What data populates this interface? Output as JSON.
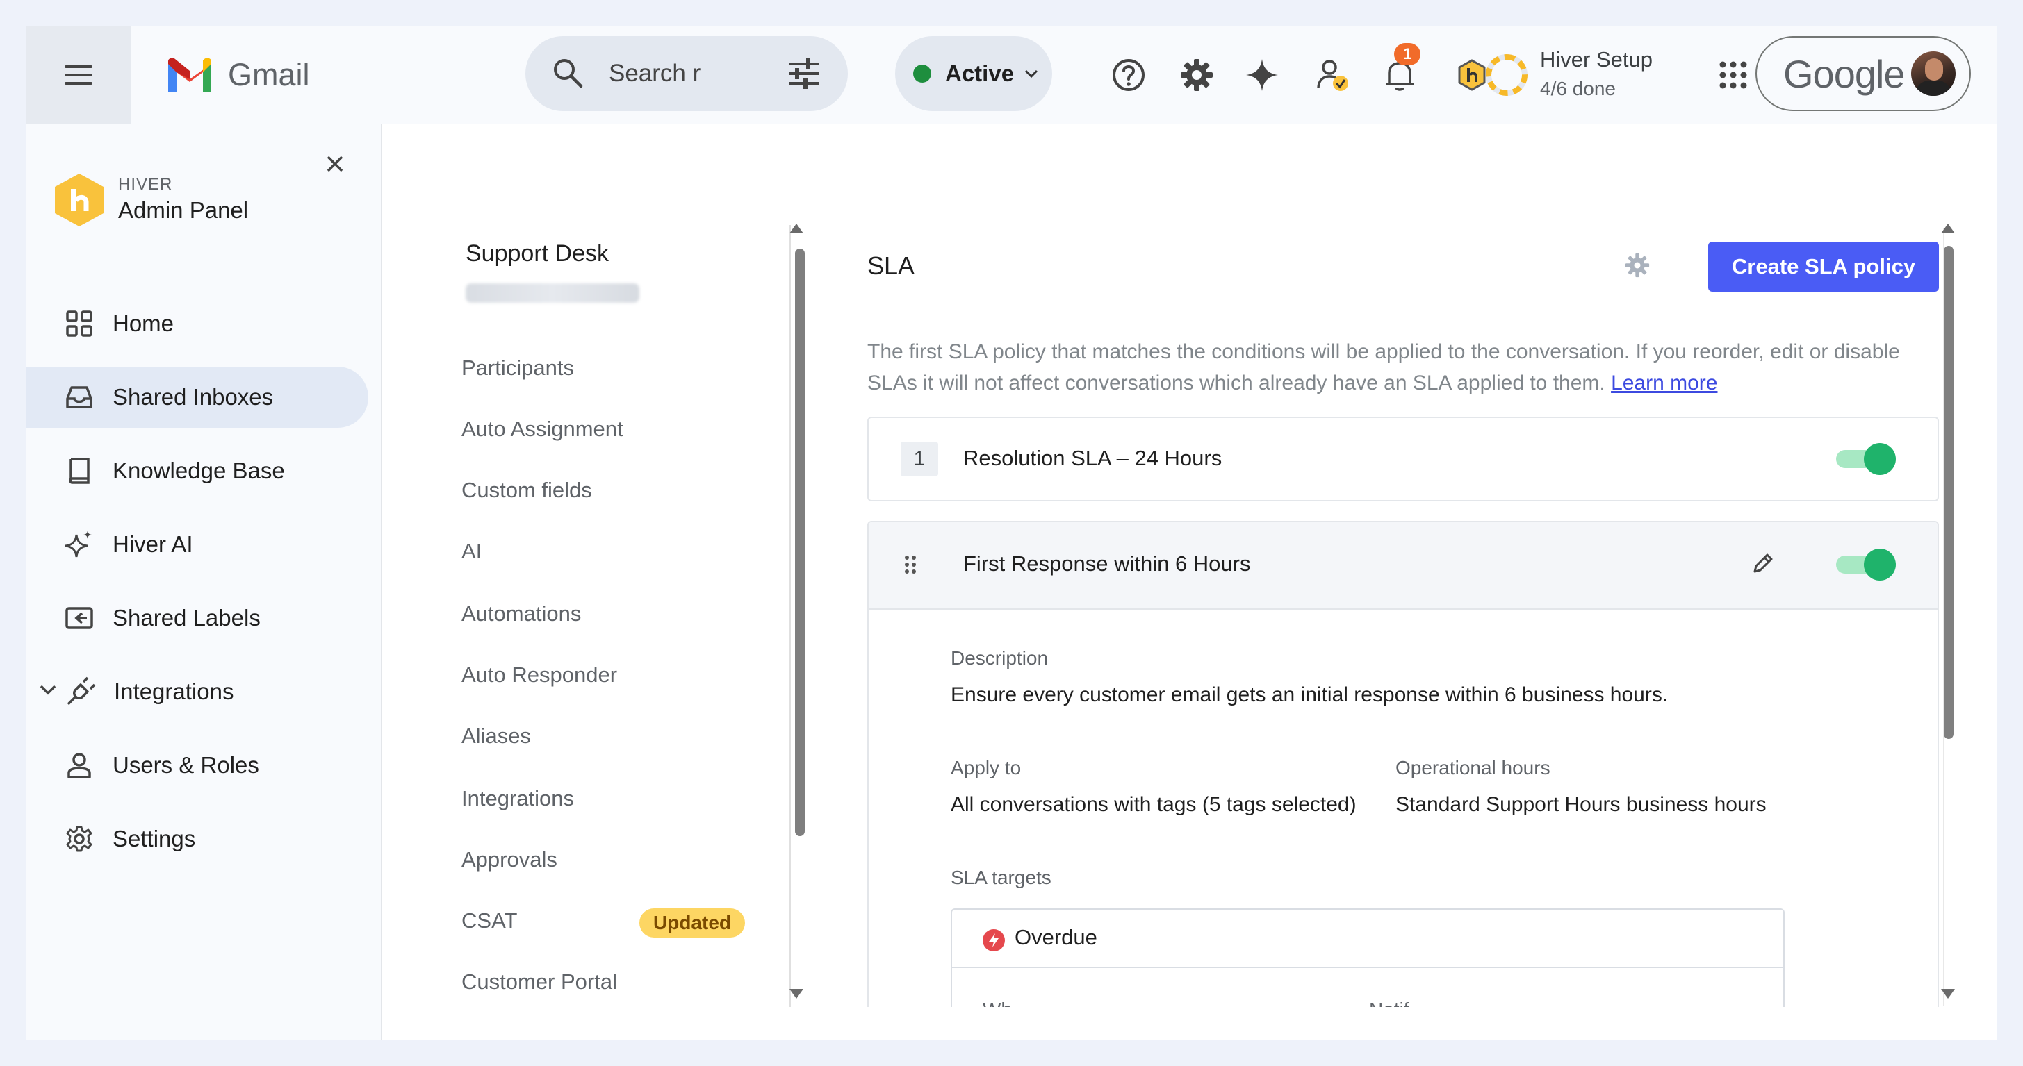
{
  "topbar": {
    "app_name": "Gmail",
    "search_placeholder": "Search r",
    "status_label": "Active",
    "notification_count": "1",
    "setup_title": "Hiver Setup",
    "setup_progress": "4/6 done",
    "setup_fraction": 0.667,
    "account_brand": "Google"
  },
  "sidebar": {
    "brand_top": "HIVER",
    "brand_bottom": "Admin Panel",
    "items": [
      {
        "label": "Home",
        "icon": "grid-icon"
      },
      {
        "label": "Shared Inboxes",
        "icon": "inbox-icon",
        "active": true
      },
      {
        "label": "Knowledge Base",
        "icon": "book-icon"
      },
      {
        "label": "Hiver AI",
        "icon": "sparkle-icon"
      },
      {
        "label": "Shared Labels",
        "icon": "label-icon"
      },
      {
        "label": "Integrations",
        "icon": "plug-icon"
      },
      {
        "label": "Users & Roles",
        "icon": "user-icon"
      },
      {
        "label": "Settings",
        "icon": "gear-icon"
      }
    ]
  },
  "subnav": {
    "title": "Support Desk",
    "items": [
      {
        "label": "Participants"
      },
      {
        "label": "Auto Assignment"
      },
      {
        "label": "Custom fields"
      },
      {
        "label": "AI"
      },
      {
        "label": "Automations"
      },
      {
        "label": "Auto Responder"
      },
      {
        "label": "Aliases"
      },
      {
        "label": "Integrations"
      },
      {
        "label": "Approvals"
      },
      {
        "label": "CSAT",
        "badge": "Updated"
      },
      {
        "label": "Customer Portal"
      }
    ]
  },
  "sla": {
    "title": "SLA",
    "create_button": "Create SLA policy",
    "intro": "The first SLA policy that matches the conditions will be applied to the conversation. If you reorder, edit or disable SLAs it will not affect conversations which already have an SLA applied to them.",
    "learn_more": "Learn more",
    "policies": [
      {
        "number": "1",
        "name": "Resolution SLA – 24 Hours",
        "enabled": true
      },
      {
        "name": "First Response within 6 Hours",
        "enabled": true,
        "description_label": "Description",
        "description": "Ensure every customer email gets an initial response within 6 business hours.",
        "apply_to_label": "Apply to",
        "apply_to": "All conversations with tags (5 tags selected)",
        "hours_label": "Operational hours",
        "hours": "Standard Support Hours business hours",
        "targets_label": "SLA targets",
        "target_name": "Overdue",
        "col_when": "Wh",
        "col_notify": "Notif"
      }
    ]
  },
  "colors": {
    "accent_button": "#4a5cf5",
    "toggle_on": "#1fb36b",
    "badge_yellow": "#fdd663",
    "status_green": "#1e8e3e"
  }
}
